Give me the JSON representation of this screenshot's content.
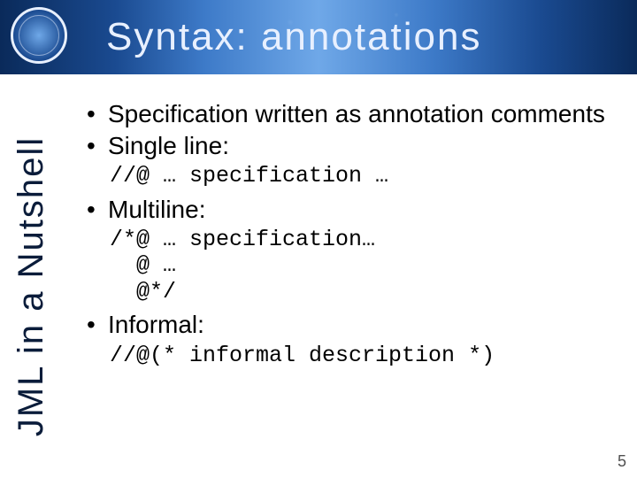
{
  "slide": {
    "title": "Syntax: annotations",
    "sidebar": "JML in a Nutshell",
    "page_number": "5",
    "bullets": {
      "spec_written": "Specification written as annotation comments",
      "single_line": "Single line:",
      "single_line_code": "//@ … specification …",
      "multiline": "Multiline:",
      "multiline_code": "/*@ … specification…\n  @ …\n  @*/",
      "informal": "Informal:",
      "informal_code": "//@(* informal description *)"
    },
    "seal_name": "politecnico-milano-seal"
  }
}
